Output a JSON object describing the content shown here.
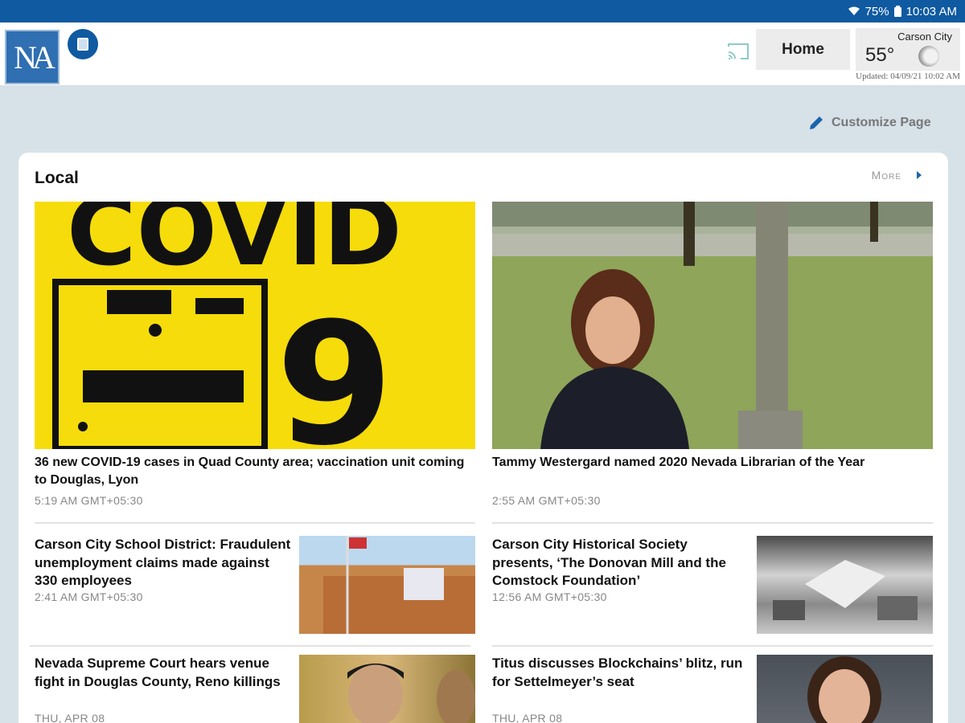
{
  "status": {
    "battery": "75%",
    "time": "10:03 AM"
  },
  "header": {
    "logo_text": "NA",
    "home_label": "Home",
    "weather": {
      "city": "Carson City",
      "temp": "55°"
    },
    "updated": "Updated: 04/09/21 10:02 AM"
  },
  "customize_label": "Customize Page",
  "section": {
    "title": "Local",
    "more_label": "More"
  },
  "features": [
    {
      "headline": "36 new COVID-19 cases in Quad County area; vaccination unit coming to Douglas, Lyon",
      "time": "5:19 AM GMT+05:30",
      "image": "COVID-19 sign"
    },
    {
      "headline": "Tammy Westergard named 2020 Nevada Librarian of the Year",
      "time": "2:55 AM GMT+05:30",
      "image": "woman in park"
    }
  ],
  "stories": [
    {
      "headline": "Carson City School District: Fraudulent unemployment claims made against 330 employees",
      "time": "2:41 AM GMT+05:30"
    },
    {
      "headline": "Carson City Historical Society presents, ‘The Donovan Mill and the Comstock Foundation’",
      "time": "12:56 AM GMT+05:30"
    },
    {
      "headline": "Nevada Supreme Court hears venue fight in Douglas County, Reno killings",
      "time": "THU, APR 08"
    },
    {
      "headline": "Titus discusses Blockchains’ blitz, run for Settelmeyer’s seat",
      "time": "THU, APR 08"
    }
  ],
  "colors": {
    "status_bar": "#0f5aa0",
    "background": "#d7e1e8",
    "accent": "#0f5aa0"
  }
}
